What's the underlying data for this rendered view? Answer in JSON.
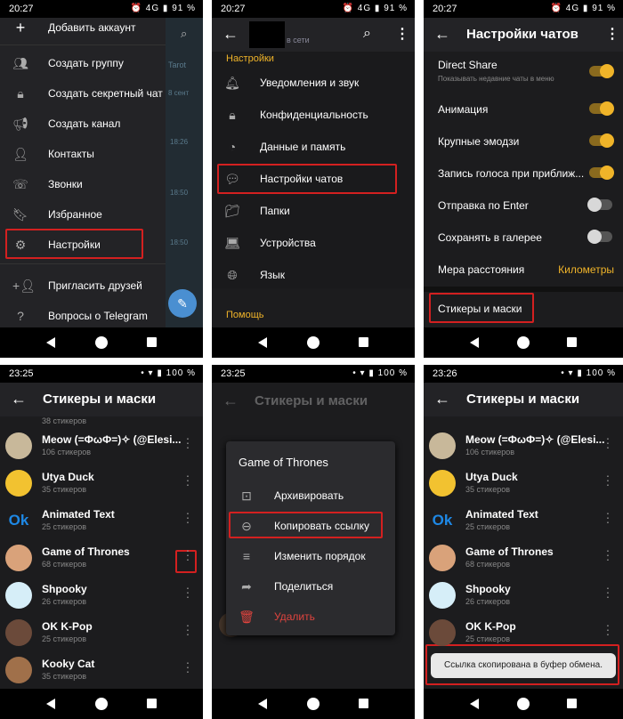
{
  "status_top": {
    "p1": {
      "time": "20:27",
      "battery": "91 %"
    },
    "p2": {
      "time": "20:27",
      "battery": "91 %"
    },
    "p3": {
      "time": "20:27",
      "battery": "91 %"
    }
  },
  "status_bottom": {
    "p4": {
      "time": "23:25",
      "battery": "100 %"
    },
    "p5": {
      "time": "23:25",
      "battery": "100 %"
    },
    "p6": {
      "time": "23:26",
      "battery": "100 %"
    }
  },
  "panel1": {
    "add_account": "Добавить аккаунт",
    "menu": [
      "Создать группу",
      "Создать секретный чат",
      "Создать канал",
      "Контакты",
      "Звонки",
      "Избранное",
      "Настройки"
    ],
    "menu_icons": [
      "people-icon",
      "lock-icon",
      "megaphone-icon",
      "person-icon",
      "phone-icon",
      "bookmark-icon",
      "gear-icon"
    ],
    "extra": [
      "Пригласить друзей",
      "Вопросы о Telegram"
    ],
    "extra_icons": [
      "add-person-icon",
      "help-icon"
    ],
    "bg_texts": [
      "Tarot",
      "8 сент",
      "18:26",
      "18:50",
      "18:50"
    ]
  },
  "panel2": {
    "subtitle": "в сети",
    "section": "Настройки",
    "items": [
      "Уведомления и звук",
      "Конфиденциальность",
      "Данные и память",
      "Настройки чатов",
      "Папки",
      "Устройства",
      "Язык"
    ],
    "item_icons": [
      "bell-icon",
      "lock-icon",
      "pie-chart-icon",
      "chat-bubble-icon",
      "folder-icon",
      "laptop-icon",
      "globe-icon"
    ],
    "help": "Помощь"
  },
  "panel3": {
    "title": "Настройки чатов",
    "direct_share": "Direct Share",
    "direct_share_sub": "Показывать недавние чаты в меню",
    "rows": [
      {
        "label": "Анимация",
        "on": true
      },
      {
        "label": "Крупные эмодзи",
        "on": true
      },
      {
        "label": "Запись голоса при приближ...",
        "on": true
      },
      {
        "label": "Отправка по Enter",
        "on": false
      },
      {
        "label": "Сохранять в галерее",
        "on": false
      }
    ],
    "distance_label": "Мера расстояния",
    "distance_value": "Километры",
    "stickers": "Стикеры и маски"
  },
  "stickers": {
    "title": "Стикеры и маски",
    "top_count": "38 стикеров",
    "items": [
      {
        "name": "Meow (=ФωФ=)✧ (@Elesi...",
        "count": "106 стикеров",
        "icon": "cat-sticker-icon"
      },
      {
        "name": "Utya Duck",
        "count": "35 стикеров",
        "icon": "duck-sticker-icon"
      },
      {
        "name": "Animated Text",
        "count": "25 стикеров",
        "icon": "ok-text-sticker-icon"
      },
      {
        "name": "Game of Thrones",
        "count": "68 стикеров",
        "icon": "got-sticker-icon"
      },
      {
        "name": "Shpooky",
        "count": "26 стикеров",
        "icon": "ghost-sticker-icon"
      },
      {
        "name": "OK K-Pop",
        "count": "25 стикеров",
        "icon": "kpop-sticker-icon"
      },
      {
        "name": "Kooky Cat",
        "count": "35 стикеров",
        "icon": "kooky-cat-sticker-icon"
      }
    ]
  },
  "panel5": {
    "menu_title": "Game of Thrones",
    "menu": [
      "Архивировать",
      "Копировать ссылку",
      "Изменить порядок",
      "Поделиться",
      "Удалить"
    ],
    "menu_icons": [
      "archive-icon",
      "link-icon",
      "reorder-icon",
      "share-icon",
      "delete-icon"
    ],
    "bg_partial": "Meow (=ΦωΦ=)✧ (@Elesi..."
  },
  "panel6": {
    "toast": "Ссылка скопирована в буфер обмена."
  },
  "colors": {
    "accent": "#f0b429",
    "highlight": "#d32020",
    "bg": "#1c1c1e",
    "delete": "#e0443e"
  }
}
